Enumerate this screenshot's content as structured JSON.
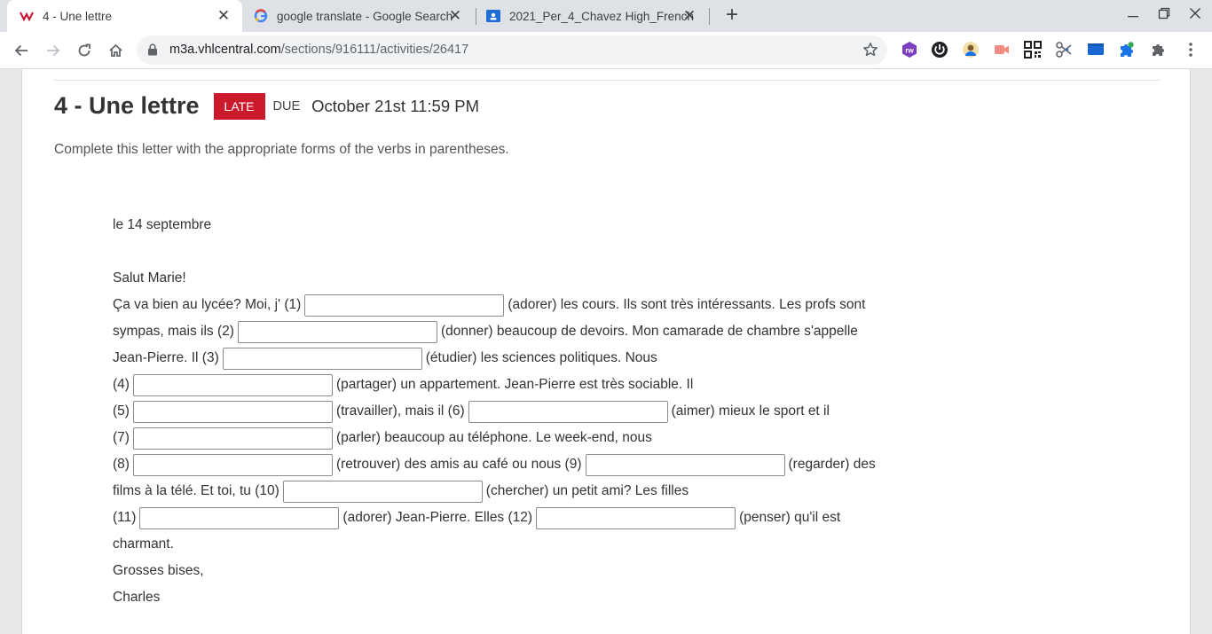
{
  "browser": {
    "tabs": [
      {
        "title": "4 - Une lettre",
        "icon": "vhl-logo-icon",
        "active": true
      },
      {
        "title": "google translate - Google Search",
        "icon": "google-icon",
        "active": false
      },
      {
        "title": "2021_Per_4_Chavez High_French",
        "icon": "classroom-icon",
        "active": false
      }
    ],
    "url_host": "m3a.vhlcentral.com",
    "url_path": "/sections/916111/activities/26417",
    "extensions": [
      "rw-extension-icon",
      "power-icon",
      "user-extension-icon",
      "screencast-icon",
      "qr-code-icon",
      "scissors-icon",
      "screen-icon",
      "puzzle-blue-icon",
      "extensions-puzzle-icon",
      "kebab-menu-icon"
    ]
  },
  "activity": {
    "title": "4 - Une lettre",
    "status_badge": "LATE",
    "due_label": "DUE",
    "due_date": "October 21st 11:59 PM",
    "instructions": "Complete this letter with the appropriate forms of the verbs in parentheses."
  },
  "letter": {
    "date": "le 14 septembre",
    "greeting": "Salut Marie!",
    "l1_a": "Ça va bien au lycée? Moi, j' (1)",
    "l1_b": "(adorer) les cours. Ils sont très intéressants. Les profs sont",
    "l2_a": "sympas, mais ils (2)",
    "l2_b": "(donner) beaucoup de devoirs. Mon camarade de chambre s'appelle",
    "l3_a": "Jean-Pierre. Il (3)",
    "l3_b": "(étudier) les sciences politiques. Nous",
    "l4_a": "(4)",
    "l4_b": "(partager) un appartement. Jean-Pierre est très sociable. Il",
    "l5_a": "(5)",
    "l5_b": "(travailler), mais il (6)",
    "l5_c": "(aimer) mieux le sport et il",
    "l6_a": "(7)",
    "l6_b": "(parler) beaucoup au téléphone. Le week-end, nous",
    "l7_a": "(8)",
    "l7_b": "(retrouver) des amis au café ou nous (9)",
    "l7_c": "(regarder) des",
    "l8_a": "films à la télé. Et toi, tu (10)",
    "l8_b": "(chercher) un petit ami? Les filles",
    "l9_a": "(11)",
    "l9_b": "(adorer) Jean-Pierre. Elles (12)",
    "l9_c": "(penser) qu'il est",
    "l10": "charmant.",
    "closing": "Grosses bises,",
    "signature": "Charles",
    "answers": [
      "",
      "",
      "",
      "",
      "",
      "",
      "",
      "",
      "",
      "",
      "",
      ""
    ]
  }
}
